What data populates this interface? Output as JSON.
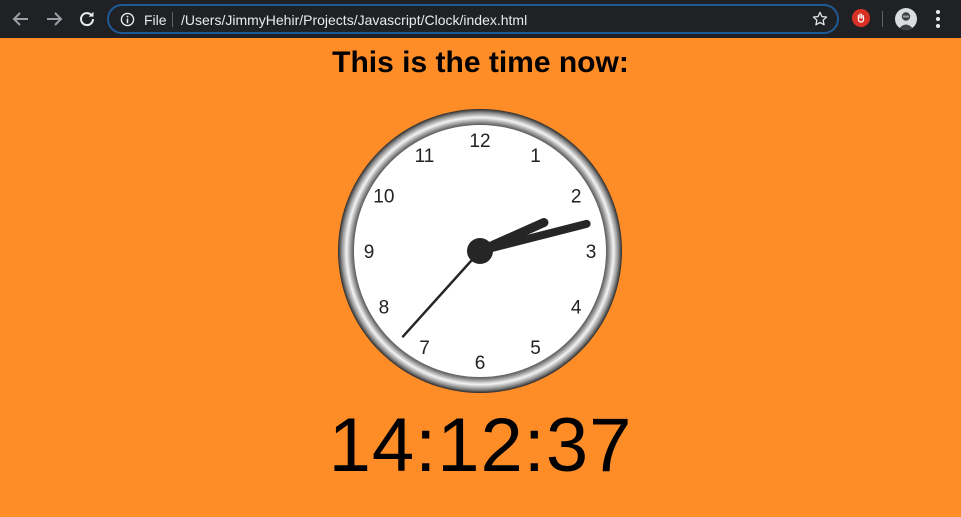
{
  "browser": {
    "file_label": "File",
    "url": "/Users/JimmyHehir/Projects/Javascript/Clock/index.html",
    "icons": {
      "back": "back-arrow-icon",
      "forward": "forward-arrow-icon",
      "reload": "reload-icon",
      "info": "info-icon",
      "star": "star-icon",
      "extension": "hand-stop-icon",
      "menu": "more-vertical-icon"
    },
    "colors": {
      "toolbar": "#202124",
      "omnibox_border": "#1f5a96"
    }
  },
  "page": {
    "title": "This is the time now:",
    "background": "#fe8c27",
    "digital_time": "14:12:37"
  },
  "clock": {
    "hour": 14,
    "minute": 12,
    "second": 37,
    "numbers": [
      "12",
      "1",
      "2",
      "3",
      "4",
      "5",
      "6",
      "7",
      "8",
      "9",
      "10",
      "11"
    ]
  }
}
